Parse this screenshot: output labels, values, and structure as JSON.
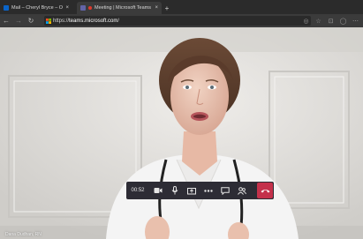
{
  "tabs": [
    {
      "title": "Mail – Cheryl Bryce – Outlook",
      "close": "×",
      "icon": "outlook-icon",
      "active": false
    },
    {
      "title": "Meeting | Microsoft Teams",
      "close": "×",
      "icon": "teams-icon",
      "active": true
    }
  ],
  "new_tab": "+",
  "address": {
    "scheme": "https://",
    "host": "teams.microsoft.com",
    "path": "/"
  },
  "call": {
    "timer": "00:52",
    "caption": "Dana Dudhan, RN"
  },
  "colors": {
    "accent_hangup": "#c4314b",
    "control_bar": "#2d2c35",
    "teams": "#6264a7"
  }
}
